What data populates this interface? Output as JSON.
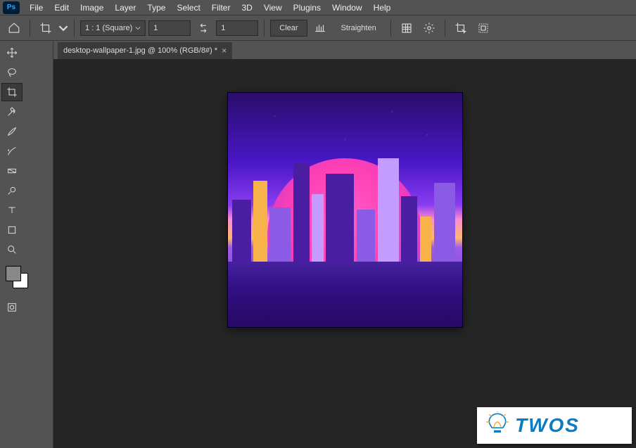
{
  "menu": {
    "items": [
      "File",
      "Edit",
      "Image",
      "Layer",
      "Type",
      "Select",
      "Filter",
      "3D",
      "View",
      "Plugins",
      "Window",
      "Help"
    ]
  },
  "optionsBar": {
    "ratio": {
      "label": "1 : 1 (Square)"
    },
    "width": "1",
    "height": "1",
    "clear": "Clear",
    "straighten": "Straighten"
  },
  "tab": {
    "title": "desktop-wallpaper-1.jpg @ 100% (RGB/8#) *"
  },
  "watermark": {
    "text": "TWOS"
  }
}
